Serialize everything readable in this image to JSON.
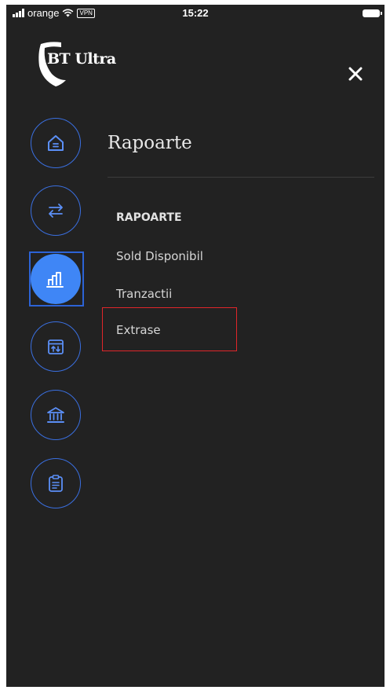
{
  "status_bar": {
    "carrier": "orange",
    "vpn_label": "VPN",
    "time": "15:22",
    "icons": [
      "signal-icon",
      "wifi-icon",
      "battery-icon"
    ]
  },
  "header": {
    "logo_text": "BT Ultra",
    "close_icon": "close-icon"
  },
  "rail": {
    "accent_color": "#3f86f6",
    "items": [
      {
        "icon": "home-icon",
        "active": false
      },
      {
        "icon": "transfer-arrows-icon",
        "active": false
      },
      {
        "icon": "chart-bars-icon",
        "active": true
      },
      {
        "icon": "exchange-card-icon",
        "active": false
      },
      {
        "icon": "bank-icon",
        "active": false
      },
      {
        "icon": "clipboard-icon",
        "active": false
      }
    ]
  },
  "panel": {
    "title": "Rapoarte",
    "section_header": "RAPOARTE",
    "items": [
      {
        "label": "Sold Disponibil"
      },
      {
        "label": "Tranzactii"
      },
      {
        "label": "Extrase"
      }
    ],
    "highlight_color": "#e0262a"
  }
}
